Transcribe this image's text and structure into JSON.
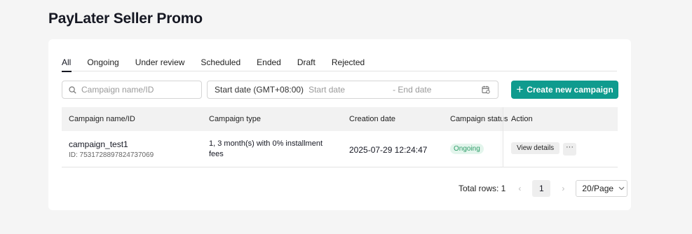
{
  "page": {
    "title": "PayLater Seller Promo"
  },
  "tabs": [
    {
      "label": "All",
      "active": true
    },
    {
      "label": "Ongoing"
    },
    {
      "label": "Under review"
    },
    {
      "label": "Scheduled"
    },
    {
      "label": "Ended"
    },
    {
      "label": "Draft"
    },
    {
      "label": "Rejected"
    }
  ],
  "filters": {
    "search_placeholder": "Campaign name/ID",
    "date_label": "Start date (GMT+08:00)",
    "date_start_placeholder": "Start date",
    "date_end_placeholder": "- End date"
  },
  "actions": {
    "create_label": "Create new campaign",
    "create_icon": "plus-icon"
  },
  "table": {
    "columns": [
      "Campaign name/ID",
      "Campaign type",
      "Creation date",
      "Campaign status",
      "Action"
    ],
    "rows": [
      {
        "name": "campaign_test1",
        "id": "ID: 7531728897824737069",
        "type": "1, 3 month(s) with 0% installment fees",
        "creation_date": "2025-07-29 12:24:47",
        "status": "Ongoing",
        "view_label": "View details",
        "more_label": "···"
      }
    ]
  },
  "pagination": {
    "total": "Total rows: 1",
    "prev": "‹",
    "current": "1",
    "next": "›",
    "page_size": "20/Page"
  },
  "colors": {
    "primary": "#0f9b8e",
    "status_bg": "#e3f5ec",
    "status_text": "#2e9c68"
  }
}
